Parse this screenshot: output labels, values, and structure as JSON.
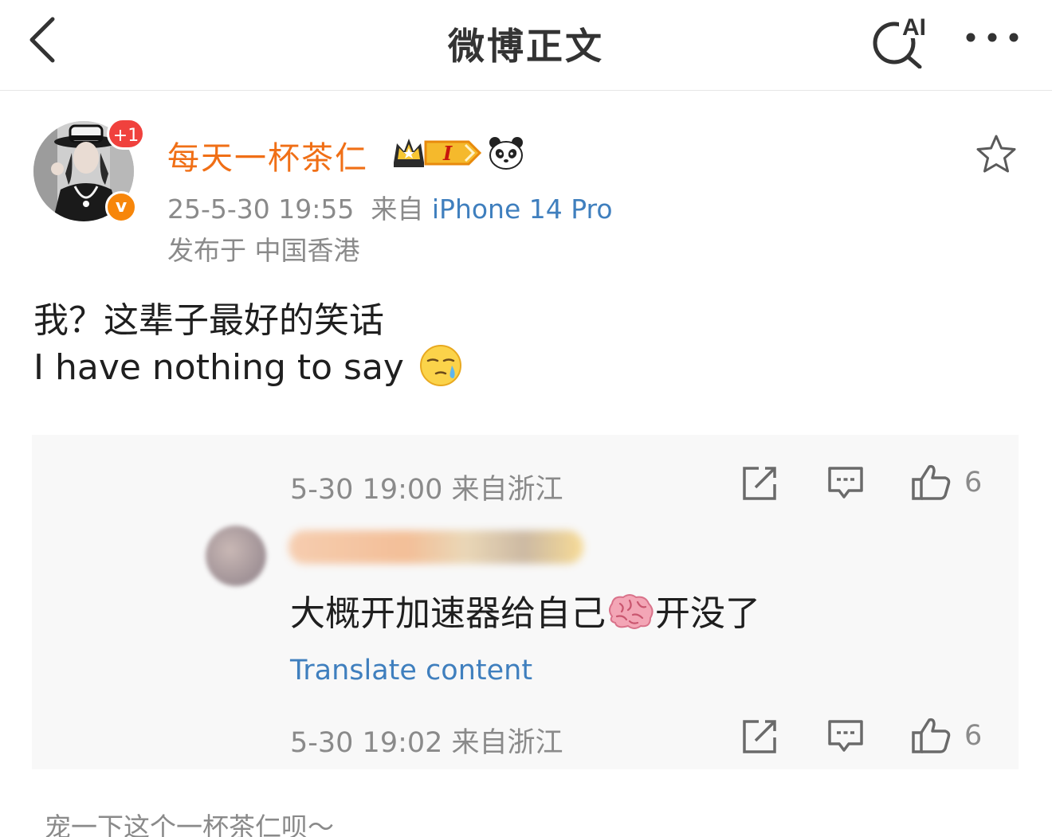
{
  "header": {
    "title": "微博正文",
    "back_icon": "chevron-left-icon",
    "ai_search_label": "AI",
    "more_icon": "more-dots-icon"
  },
  "post": {
    "avatar_badge": "+1",
    "verified_mark": "v",
    "username": "每天一杯茶仁",
    "level_badge": "I",
    "timestamp": "25-5-30 19:55",
    "source_prefix": "来自",
    "device": "iPhone 14 Pro",
    "location": "发布于 中国香港",
    "text_line1": "我？这辈子最好的笑话",
    "text_line2": "I have nothing to say"
  },
  "quoted": {
    "first_time": "5-30 19:00 来自浙江",
    "first_likes": "6",
    "comment_text_a": "大概开加速器给自己",
    "comment_text_b": "开没了",
    "translate_label": "Translate content",
    "second_time": "5-30 19:02 来自浙江",
    "second_likes": "6"
  },
  "footer": {
    "text": "宠一下这个一杯茶仁呗～"
  },
  "colors": {
    "username": "#f06f16",
    "link": "#3f7fbe",
    "meta": "#8a8a8a",
    "badge_red": "#f0413d",
    "verified_orange": "#f7860a",
    "quote_bg": "#f8f8f8"
  }
}
